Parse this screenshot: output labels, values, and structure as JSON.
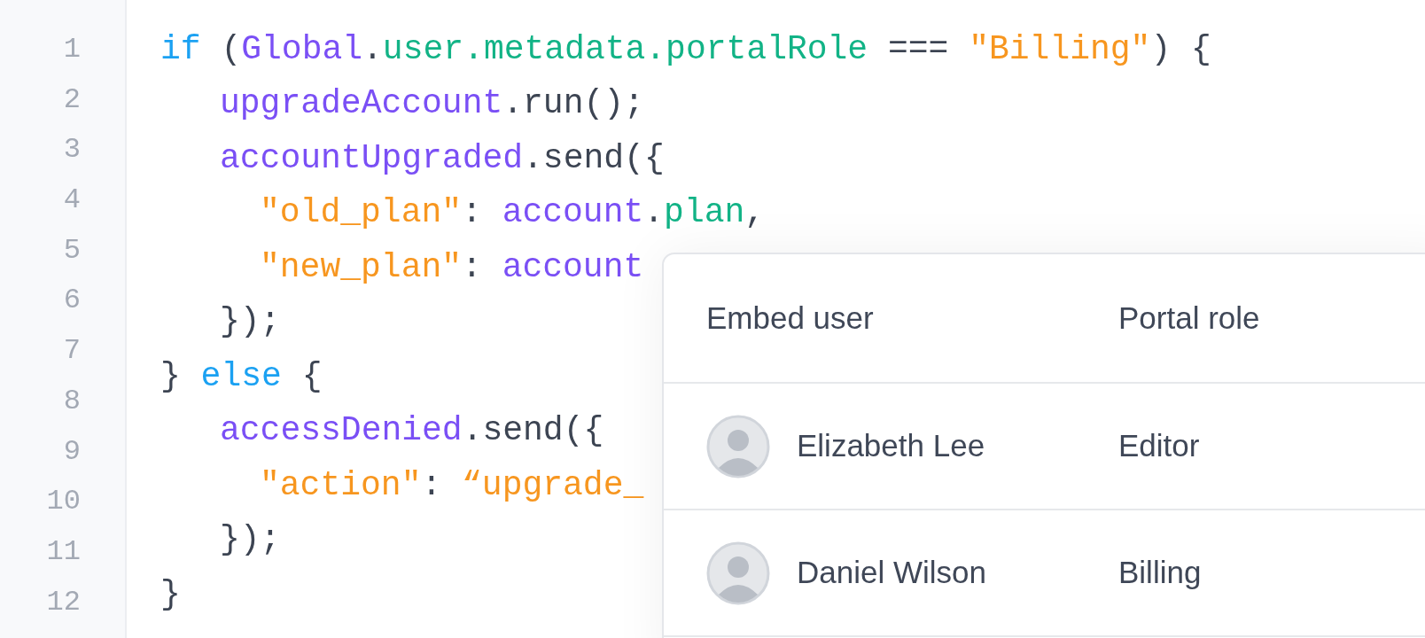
{
  "editor": {
    "line_numbers": [
      "1",
      "2",
      "3",
      "4",
      "5",
      "6",
      "7",
      "8",
      "9",
      "10",
      "11",
      "12"
    ],
    "lines": [
      {
        "tokens": [
          {
            "kind": "keyword",
            "text": "if"
          },
          {
            "kind": "plain",
            "text": " ("
          },
          {
            "kind": "variable",
            "text": "Global"
          },
          {
            "kind": "plain",
            "text": "."
          },
          {
            "kind": "property",
            "text": "user.metadata.portalRole"
          },
          {
            "kind": "plain",
            "text": " === "
          },
          {
            "kind": "string",
            "text": "\"Billing\""
          },
          {
            "kind": "plain",
            "text": ") {"
          }
        ],
        "children": [
          {
            "tokens": [
              {
                "kind": "variable",
                "text": "upgradeAccount"
              },
              {
                "kind": "plain",
                "text": ".run();"
              }
            ]
          },
          {
            "tokens": [
              {
                "kind": "variable",
                "text": "accountUpgraded"
              },
              {
                "kind": "plain",
                "text": ".send({"
              }
            ],
            "children": [
              {
                "tokens": [
                  {
                    "kind": "string",
                    "text": "\"old_plan\""
                  },
                  {
                    "kind": "plain",
                    "text": ": "
                  },
                  {
                    "kind": "variable",
                    "text": "account"
                  },
                  {
                    "kind": "plain",
                    "text": "."
                  },
                  {
                    "kind": "property",
                    "text": "plan"
                  },
                  {
                    "kind": "plain",
                    "text": ","
                  }
                ]
              },
              {
                "tokens": [
                  {
                    "kind": "string",
                    "text": "\"new_plan\""
                  },
                  {
                    "kind": "plain",
                    "text": ": "
                  },
                  {
                    "kind": "variable",
                    "text": "account"
                  }
                ]
              }
            ]
          },
          {
            "tokens": [
              {
                "kind": "plain",
                "text": "});"
              }
            ]
          }
        ]
      },
      {
        "tokens": [
          {
            "kind": "plain",
            "text": "} "
          },
          {
            "kind": "keyword",
            "text": "else"
          },
          {
            "kind": "plain",
            "text": " {"
          }
        ],
        "children": [
          {
            "tokens": [
              {
                "kind": "variable",
                "text": "accessDenied"
              },
              {
                "kind": "plain",
                "text": ".send({"
              }
            ],
            "children": [
              {
                "tokens": [
                  {
                    "kind": "string",
                    "text": "\"action\""
                  },
                  {
                    "kind": "plain",
                    "text": ": "
                  },
                  {
                    "kind": "string",
                    "text": "“upgrade_"
                  }
                ]
              }
            ]
          },
          {
            "tokens": [
              {
                "kind": "plain",
                "text": "});"
              }
            ]
          }
        ]
      },
      {
        "tokens": [
          {
            "kind": "plain",
            "text": "}"
          }
        ]
      }
    ]
  },
  "table": {
    "columns": [
      "Embed user",
      "Portal role"
    ],
    "rows": [
      {
        "name": "Elizabeth Lee",
        "role": "Editor"
      },
      {
        "name": "Daniel Wilson",
        "role": "Billing"
      }
    ]
  }
}
